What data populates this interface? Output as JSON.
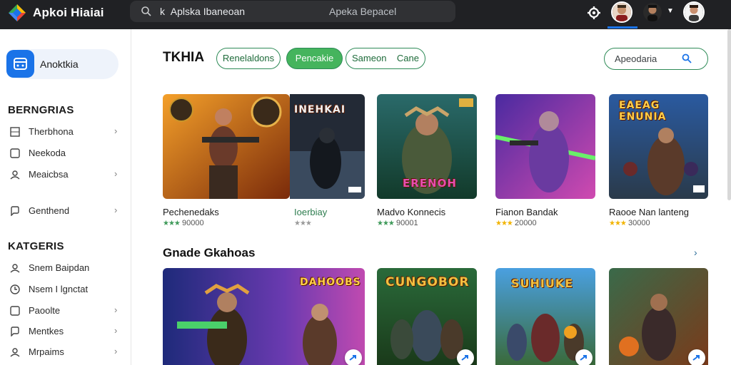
{
  "app": {
    "title": "Apkoi Hiaiai",
    "logo_icon": "diamond-logo-icon"
  },
  "top_search": {
    "prefix": "k",
    "text": "Aplska  Ibaneoan",
    "secondary": "Apeka   Bepacel"
  },
  "top_icons": [
    "settings-icon",
    "avatar",
    "avatar-with-dropdown",
    "avatar"
  ],
  "sidebar": {
    "active_app": {
      "label": "Anoktkia",
      "icon": "app-window-icon"
    },
    "section1": {
      "heading": "BERNGRIAS",
      "items": [
        {
          "label": "Therbhona",
          "icon": "grid-icon",
          "chevron": true
        },
        {
          "label": "Neekoda",
          "icon": "square-icon",
          "chevron": false
        },
        {
          "label": "Meaicbsa",
          "icon": "person-icon",
          "chevron": true
        }
      ],
      "extra": {
        "label": "Genthend",
        "icon": "chat-icon",
        "chevron": true
      }
    },
    "section2": {
      "heading": "KATGERIS",
      "items": [
        {
          "label": "Snem Baipdan",
          "icon": "person-icon",
          "chevron": false
        },
        {
          "label": "Nsem I lgnctat",
          "icon": "clock-icon",
          "chevron": false
        },
        {
          "label": "Paoolte",
          "icon": "square-icon",
          "chevron": true
        },
        {
          "label": "Mentkes",
          "icon": "chat-icon",
          "chevron": true
        },
        {
          "label": "Mrpaims",
          "icon": "person-icon",
          "chevron": true
        }
      ]
    }
  },
  "main": {
    "section_title": "TKHIA",
    "pills": [
      {
        "label": "Renelaldons",
        "active": false
      },
      {
        "label": "Pencakie",
        "active": true
      },
      {
        "label": "Sameon    Cane",
        "active": false
      }
    ],
    "search_label": "Apeodaria",
    "games_row1": [
      {
        "name": "Pechenedaks",
        "rating": "90000",
        "stars": "★★★",
        "star_color": "green",
        "banner": ""
      },
      {
        "name": "Ioerbiay",
        "rating": "",
        "stars": "★★★",
        "star_color": "gray",
        "banner": "INEHKAI"
      },
      {
        "name": "Madvo Konnecis",
        "rating": "90001",
        "stars": "★★★",
        "star_color": "green",
        "banner": "ERENOH"
      },
      {
        "name": "Fianon Bandak",
        "rating": "20000",
        "stars": "★★★",
        "star_color": "yellow",
        "banner": ""
      },
      {
        "name": "Raooe Nan lanteng",
        "rating": "30000",
        "stars": "★★★",
        "star_color": "yellow",
        "banner": "EAEAG ENUNIA"
      }
    ],
    "section_title_2": "Gnade Gkahoas",
    "see_more": "›",
    "games_row2": [
      {
        "banner": "DAHOOBS"
      },
      {
        "banner": "CUNGOBOR"
      },
      {
        "banner": "SUHIUKE"
      },
      {
        "banner": ""
      }
    ]
  },
  "colors": {
    "topbar": "#202124",
    "accent_green": "#45b45d",
    "brand_blue": "#1a73e8"
  }
}
